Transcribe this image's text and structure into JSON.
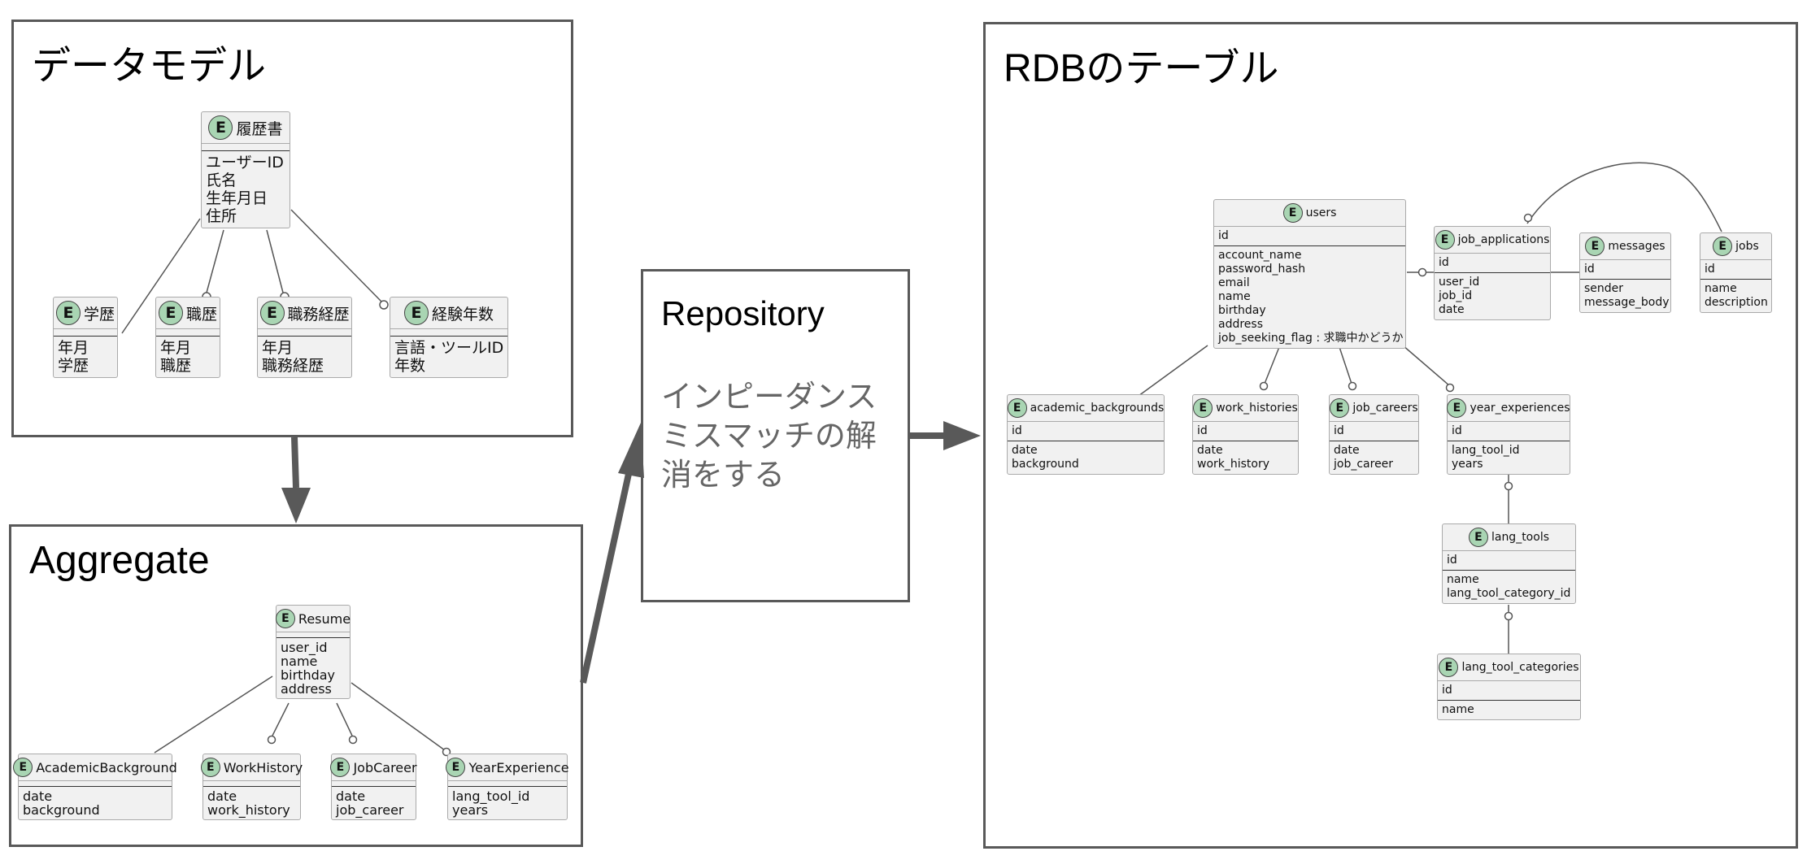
{
  "panels": {
    "data_model": {
      "title": "データモデル"
    },
    "aggregate": {
      "title": "Aggregate"
    },
    "repository": {
      "title": "Repository",
      "note": "インピーダンスミスマッチの解消をする"
    },
    "rdb": {
      "title": "RDBのテーブル"
    }
  },
  "entity_badge": "E",
  "data_model_entities": {
    "resume": {
      "name": "履歴書",
      "attrs": [
        "ユーザーID",
        "氏名",
        "生年月日",
        "住所"
      ]
    },
    "education": {
      "name": "学歴",
      "attrs": [
        "年月",
        "学歴"
      ]
    },
    "work": {
      "name": "職歴",
      "attrs": [
        "年月",
        "職歴"
      ]
    },
    "career": {
      "name": "職務経歴",
      "attrs": [
        "年月",
        "職務経歴"
      ]
    },
    "experience": {
      "name": "経験年数",
      "attrs": [
        "言語・ツールID",
        "年数"
      ]
    }
  },
  "aggregate_entities": {
    "resume": {
      "name": "Resume",
      "attrs": [
        "user_id",
        "name",
        "birthday",
        "address"
      ]
    },
    "academic": {
      "name": "AcademicBackground",
      "attrs": [
        "date",
        "background"
      ]
    },
    "work": {
      "name": "WorkHistory",
      "attrs": [
        "date",
        "work_history"
      ]
    },
    "career": {
      "name": "JobCareer",
      "attrs": [
        "date",
        "job_career"
      ]
    },
    "experience": {
      "name": "YearExperience",
      "attrs": [
        "lang_tool_id",
        "years"
      ]
    }
  },
  "rdb_tables": {
    "users": {
      "name": "users",
      "pk": "id",
      "attrs": [
        "account_name",
        "password_hash",
        "email",
        "name",
        "birthday",
        "address",
        "job_seeking_flag : 求職中かどうか"
      ]
    },
    "job_applications": {
      "name": "job_applications",
      "pk": "id",
      "attrs": [
        "user_id",
        "job_id",
        "date"
      ]
    },
    "messages": {
      "name": "messages",
      "pk": "id",
      "attrs": [
        "sender",
        "message_body"
      ]
    },
    "jobs": {
      "name": "jobs",
      "pk": "id",
      "attrs": [
        "name",
        "description"
      ]
    },
    "academic_backgrounds": {
      "name": "academic_backgrounds",
      "pk": "id",
      "attrs": [
        "date",
        "background"
      ]
    },
    "work_histories": {
      "name": "work_histories",
      "pk": "id",
      "attrs": [
        "date",
        "work_history"
      ]
    },
    "job_careers": {
      "name": "job_careers",
      "pk": "id",
      "attrs": [
        "date",
        "job_career"
      ]
    },
    "year_experiences": {
      "name": "year_experiences",
      "pk": "id",
      "attrs": [
        "lang_tool_id",
        "years"
      ]
    },
    "lang_tools": {
      "name": "lang_tools",
      "pk": "id",
      "attrs": [
        "name",
        "lang_tool_category_id"
      ]
    },
    "lang_tool_categories": {
      "name": "lang_tool_categories",
      "pk": "id",
      "attrs": [
        "name"
      ]
    }
  },
  "relationships": [
    {
      "from": "履歴書",
      "to": "学歴",
      "cardinality": "one-to-one-or-many"
    },
    {
      "from": "履歴書",
      "to": "職歴",
      "cardinality": "one-to-zero-or-many"
    },
    {
      "from": "履歴書",
      "to": "職務経歴",
      "cardinality": "one-to-zero-or-many"
    },
    {
      "from": "履歴書",
      "to": "経験年数",
      "cardinality": "one-to-zero-or-many"
    },
    {
      "from": "Resume",
      "to": "AcademicBackground",
      "cardinality": "one-to-one-or-many"
    },
    {
      "from": "Resume",
      "to": "WorkHistory",
      "cardinality": "one-to-zero-or-many"
    },
    {
      "from": "Resume",
      "to": "JobCareer",
      "cardinality": "one-to-zero-or-many"
    },
    {
      "from": "Resume",
      "to": "YearExperience",
      "cardinality": "one-to-zero-or-many"
    },
    {
      "from": "users",
      "to": "job_applications",
      "cardinality": "one-to-zero-or-many"
    },
    {
      "from": "job_applications",
      "to": "messages",
      "cardinality": "one-to-one-or-many"
    },
    {
      "from": "jobs",
      "to": "job_applications",
      "cardinality": "one-to-zero-or-many"
    },
    {
      "from": "users",
      "to": "academic_backgrounds",
      "cardinality": "one-to-one-or-many"
    },
    {
      "from": "users",
      "to": "work_histories",
      "cardinality": "one-to-zero-or-many"
    },
    {
      "from": "users",
      "to": "job_careers",
      "cardinality": "one-to-zero-or-many"
    },
    {
      "from": "users",
      "to": "year_experiences",
      "cardinality": "one-to-zero-or-many"
    },
    {
      "from": "lang_tools",
      "to": "year_experiences",
      "cardinality": "one-to-zero-or-many"
    },
    {
      "from": "lang_tool_categories",
      "to": "lang_tools",
      "cardinality": "one-to-zero-or-many"
    }
  ],
  "flow": [
    {
      "from": "データモデル",
      "to": "Aggregate"
    },
    {
      "from": "Aggregate",
      "to": "Repository"
    },
    {
      "from": "Repository",
      "to": "RDBのテーブル"
    }
  ]
}
